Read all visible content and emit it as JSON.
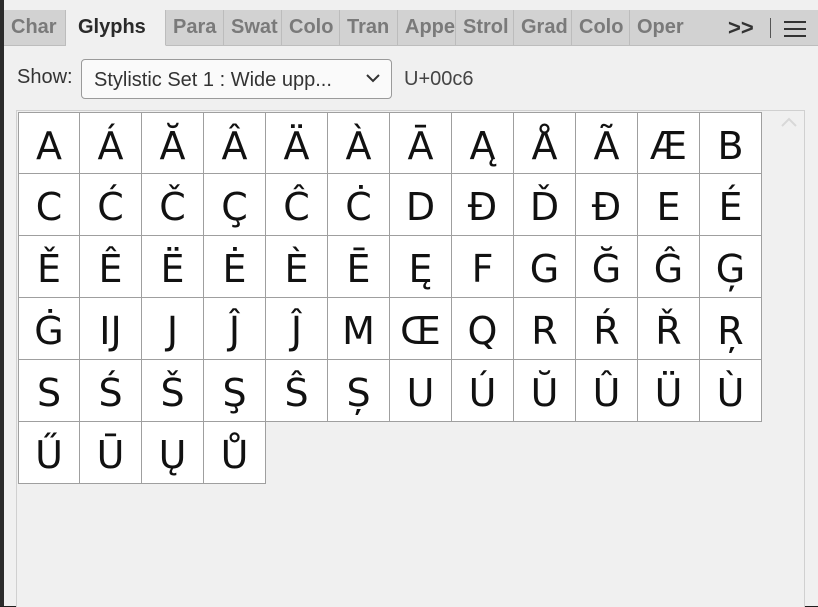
{
  "tabs": [
    {
      "label": "Char",
      "active": false
    },
    {
      "label": "Glyphs",
      "active": true
    },
    {
      "label": "Para",
      "active": false
    },
    {
      "label": "Swat",
      "active": false
    },
    {
      "label": "Colo",
      "active": false
    },
    {
      "label": "Tran",
      "active": false
    },
    {
      "label": "Appe",
      "active": false
    },
    {
      "label": "Strol",
      "active": false
    },
    {
      "label": "Grad",
      "active": false
    },
    {
      "label": "Colo",
      "active": false
    },
    {
      "label": "Oper",
      "active": false
    }
  ],
  "tab_overflow": ">>",
  "show_label": "Show:",
  "show_selected": "Stylistic Set 1 : Wide upp...",
  "unicode_value": "U+00c6",
  "glyphs": [
    "A",
    "Á",
    "Ă",
    "Â",
    "Ä",
    "À",
    "Ā",
    "Ą",
    "Å",
    "Ã",
    "Æ",
    "B",
    "C",
    "Ć",
    "Č",
    "Ç",
    "Ĉ",
    "Ċ",
    "D",
    "Đ",
    "Ď",
    "Đ",
    "E",
    "É",
    "Ě",
    "Ê",
    "Ë",
    "Ė",
    "È",
    "Ē",
    "Ę",
    "F",
    "G",
    "Ğ",
    "Ĝ",
    "Ģ",
    "Ġ",
    "IJ",
    "J",
    "Ĵ",
    "Ĵ",
    "M",
    "Œ",
    "Q",
    "R",
    "Ŕ",
    "Ř",
    "Ŗ",
    "S",
    "Ś",
    "Š",
    "Ş",
    "Ŝ",
    "Ș",
    "U",
    "Ú",
    "Ŭ",
    "Û",
    "Ü",
    "Ù",
    "Ű",
    "Ū",
    "Ų",
    "Ů"
  ],
  "colors": {
    "panel_bg": "#f0f0f0",
    "tabbar_bg": "#d2d2d2",
    "cell_border": "#9f9f9f"
  }
}
